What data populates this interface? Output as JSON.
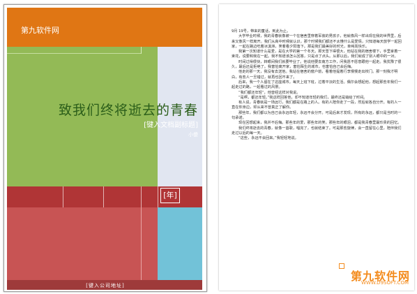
{
  "cover": {
    "site_name": "第九软件网",
    "title": "致我们终将逝去的青春",
    "subtitle": "[键入文档副标题]",
    "author": "小傻",
    "year": "[年]",
    "company": "[键入公司地址]",
    "colors": {
      "orange": "#e07614",
      "green": "#93ba56",
      "lavender": "#e1e6f1",
      "maroon": "#b03536",
      "red": "#c85454",
      "cyan": "#72c2d8"
    }
  },
  "body": {
    "paragraphs": [
      "9月 19号，带来的童话，到此为止。",
      "大学毕业时候，我的青春就像被一个在宿舍里穿着军装的男孩子，他就像风一样出现在我的世界里，后来又像风一样离开。我们从高中时候就认识，那个时候我们都还不太懂什么是爱情，只知道每天放学一起回家，一起在路边吃着冰淇淋，笑着看夕阳落下。那是我们最美好的时光，单纯而快乐。",
      "我第一次知道什么是爱，是在大学的第一个冬天。那天雪下得很大，他站在我的宿舍楼下，手里拿着一束花，说要和我在一起。我不知道该怎么回答，只是点了点头。从那以后，我们就成了别人眼中的一对。",
      "时间过得很快，转眼间我们就要毕业了。他说他要去南方工作，问我愿不愿意跟他一起走。我犹豫了很久，最后还是拒绝了。我害怕离开家，害怕陌生的城市，也害怕自己会后悔。",
      "他走的那一天，我没有去送他。我站在宿舍的窗户前，看着他提着行李慢慢走出校门。那一刻我才明白，有些人一旦错过，就再也回不来了。",
      "后来，我一个人留在了这座城市。每天上班下班，过着平淡的生活。偶尔会想起他，想起那些年我们一起走过的路，一起看过的风景。",
      "“我们都还年轻”，他曾经这样对我说。",
      "“是啊，都还年轻。”我这样回答他，却不知道年轻的我们，最终还是输给了时间。",
      "有人说，青春就是一场远行，我们都是在路上的人。有的人陪你走了一段，然后就各自分开。有的人一直在你身边，却从来不曾真正了解你。",
      "那些年，我们都以为自己会永远年轻，永远不会分开。可是后来才发现，所有的永远，都只是当时的一句承诺。",
      "现在回想起来，我并不后悔。那些年的爱，那些年的笑，那些年的眼泪，都是我青春里最珍贵的回忆。",
      "我们终将逝去的青春，就像一首歌，唱完了，也就结束了。可是那些旋律，会一直留在心里，陪伴我们走过以后的每一天。",
      "“这些，永远不会回来。”我轻轻地说。"
    ]
  },
  "watermark": {
    "brand": "第九软件网",
    "url": "WWW.D9SOFT.COM"
  }
}
